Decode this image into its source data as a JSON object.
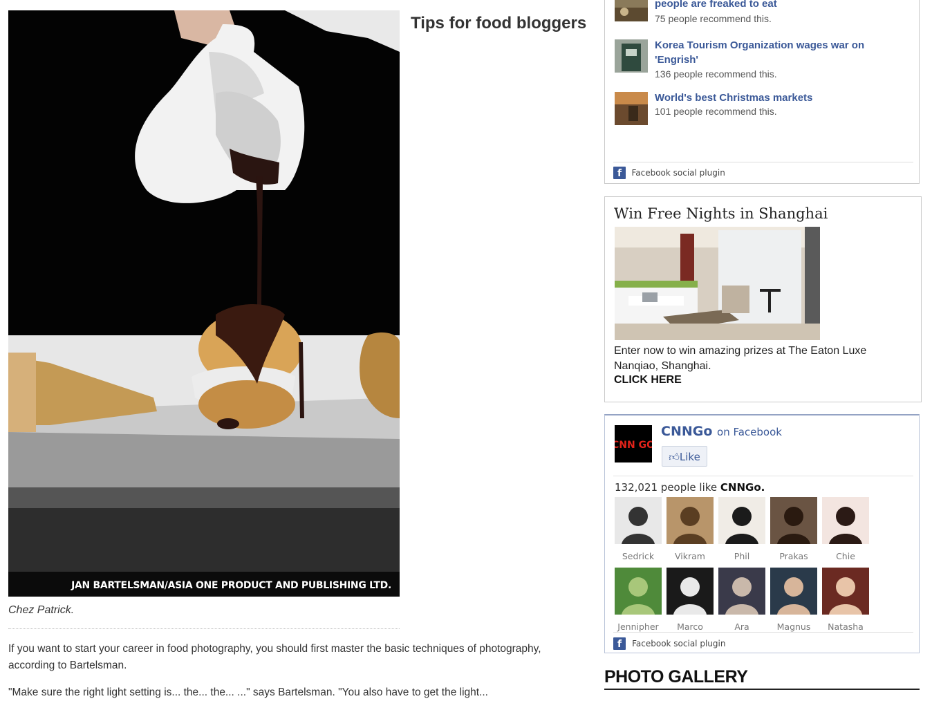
{
  "article": {
    "title": "Tips for food bloggers",
    "photo_credit": "JAN BARTELSMAN/ASIA ONE PRODUCT AND PUBLISHING LTD.",
    "caption": "Chez Patrick.",
    "paragraph1": "If you want to start your career in food photography, you should first master the basic techniques of photography, according to Bartelsman.",
    "paragraph2_partial": "\"Make sure the right light setting is... the... the... ...\" says Bartelsman. \"You also have to get the light..."
  },
  "recommendations": {
    "items": [
      {
        "title": "people are freaked to eat",
        "count": "75 people recommend this."
      },
      {
        "title": "Korea Tourism Organization wages war on 'Engrish'",
        "count": "136 people recommend this."
      },
      {
        "title": "World's best Christmas markets",
        "count": "101 people recommend this."
      }
    ],
    "plugin_label": "Facebook social plugin"
  },
  "promo": {
    "title": "Win Free Nights in Shanghai",
    "text": "Enter now to win amazing prizes at The Eaton Luxe Nanqiao, Shanghai.",
    "cta": "CLICK HERE"
  },
  "facebook_likebox": {
    "page_name": "CNNGo",
    "on_label": "on Facebook",
    "logo_text": "CNN GO",
    "like_button": "Like",
    "count_prefix": "132,021 people like",
    "count_page": "CNNGo.",
    "fans": [
      "Sedrick",
      "Vikram",
      "Phil",
      "Prakas",
      "Chie",
      "Jennipher",
      "Marco",
      "Ara",
      "Magnus",
      "Natasha"
    ],
    "plugin_label": "Facebook social plugin"
  },
  "gallery": {
    "heading": "PHOTO GALLERY"
  },
  "colors": {
    "facebook_blue": "#3b5998",
    "link": "#3b5998"
  },
  "icons": [
    "facebook-f-icon",
    "thumbs-up-icon"
  ]
}
